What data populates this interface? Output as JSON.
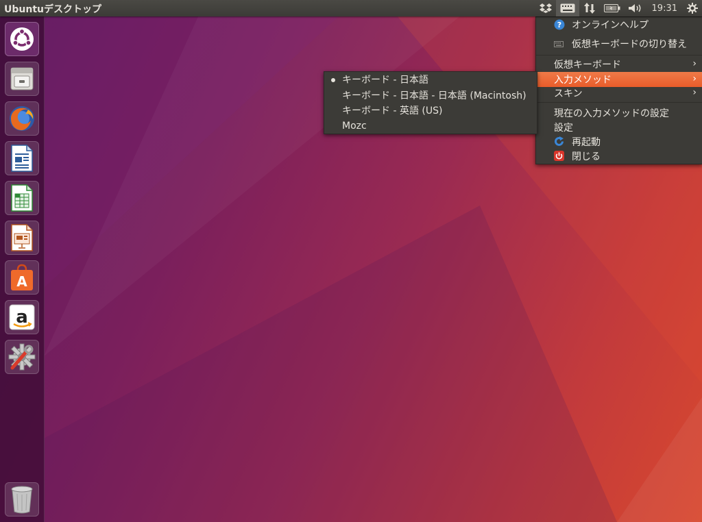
{
  "panel": {
    "title": "Ubuntuデスクトップ",
    "clock": "19:31"
  },
  "main_menu": {
    "items": [
      {
        "label": "オンラインヘルプ",
        "icon": "help-icon"
      },
      {
        "label": "仮想キーボードの切り替え",
        "icon": "keyboard-icon"
      },
      {
        "label": "仮想キーボード"
      },
      {
        "label": "入力メソッド"
      },
      {
        "label": "スキン"
      },
      {
        "label": "現在の入力メソッドの設定"
      },
      {
        "label": "設定"
      },
      {
        "label": "再起動",
        "icon": "restart-icon"
      },
      {
        "label": "閉じる",
        "icon": "power-icon"
      }
    ]
  },
  "submenu": {
    "items": [
      {
        "label": "キーボード - 日本語",
        "selected": true
      },
      {
        "label": "キーボード - 日本語 - 日本語 (Macintosh)"
      },
      {
        "label": "キーボード - 英語 (US)"
      },
      {
        "label": "Mozc"
      }
    ]
  },
  "launcher": {
    "items": [
      "dash-home-icon",
      "files-icon",
      "firefox-icon",
      "writer-icon",
      "calc-icon",
      "impress-icon",
      "software-center-icon",
      "amazon-icon",
      "system-settings-icon",
      "trash-icon"
    ]
  },
  "colors": {
    "highlight": "#e95c2a",
    "menu_bg": "#3c3b37",
    "panel_bg": "#3c3b37"
  }
}
